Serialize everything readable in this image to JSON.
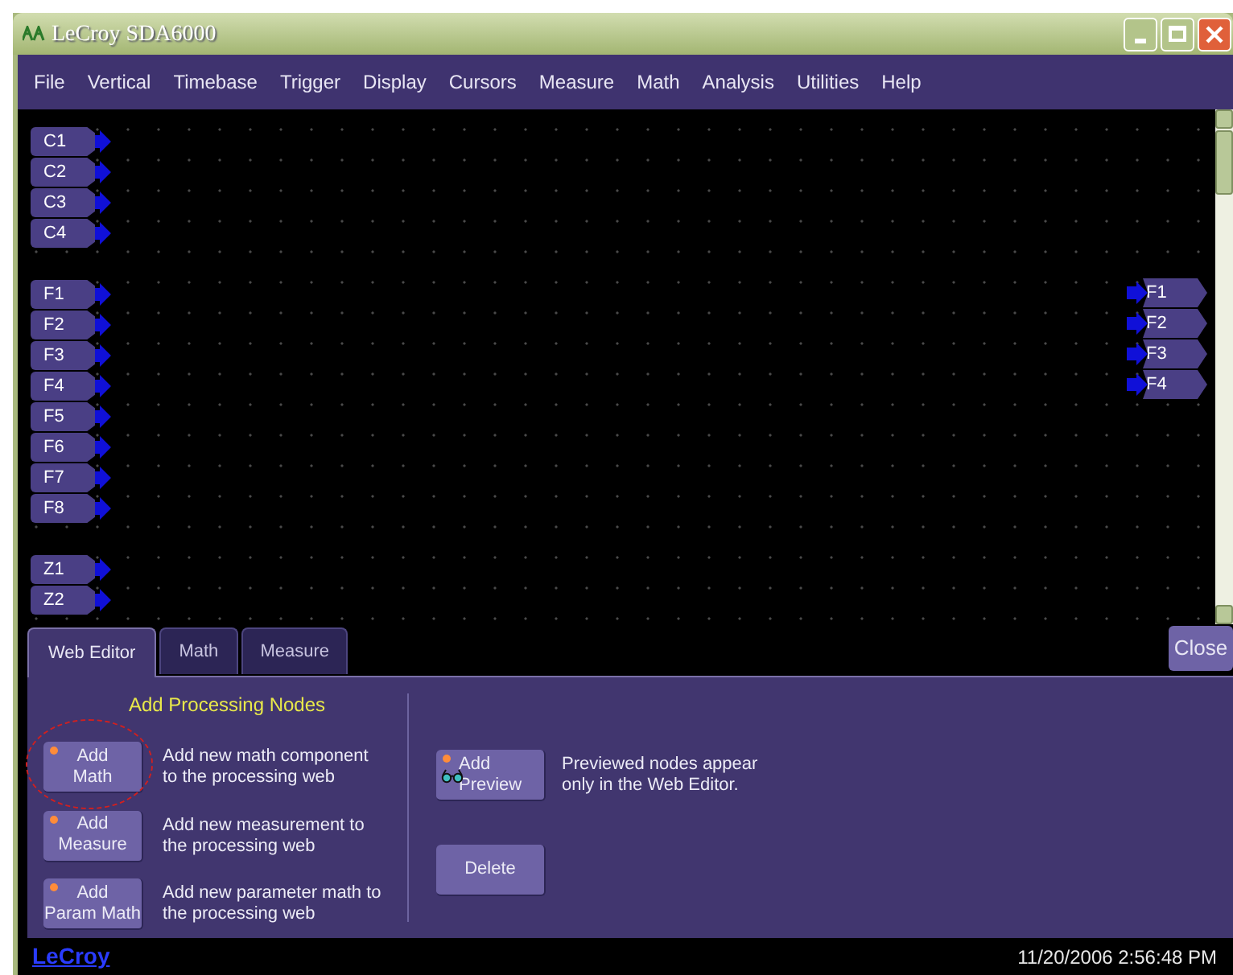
{
  "window": {
    "title": "LeCroy SDA6000"
  },
  "menu": [
    "File",
    "Vertical",
    "Timebase",
    "Trigger",
    "Display",
    "Cursors",
    "Measure",
    "Math",
    "Analysis",
    "Utilities",
    "Help"
  ],
  "web_editor": {
    "input_groups": [
      {
        "nodes": [
          "C1",
          "C2",
          "C3",
          "C4"
        ]
      },
      {
        "nodes": [
          "F1",
          "F2",
          "F3",
          "F4",
          "F5",
          "F6",
          "F7",
          "F8"
        ]
      },
      {
        "nodes": [
          "Z1",
          "Z2"
        ]
      }
    ],
    "output_nodes": [
      "F1",
      "F2",
      "F3",
      "F4"
    ]
  },
  "close_button": "Close",
  "tabs": [
    {
      "label": "Web Editor",
      "selected": true
    },
    {
      "label": "Math",
      "selected": false
    },
    {
      "label": "Measure",
      "selected": false
    }
  ],
  "panel": {
    "heading": "Add Processing Nodes",
    "actions": [
      {
        "label": "Add\nMath",
        "description": "Add new math component\nto the processing web",
        "led": true,
        "highlighted": true
      },
      {
        "label": "Add\nMeasure",
        "description": "Add new measurement to\nthe processing web",
        "led": true,
        "highlighted": false
      },
      {
        "label": "Add\nParam Math",
        "description": "Add new parameter math to\nthe processing web",
        "led": true,
        "highlighted": false
      }
    ],
    "preview": {
      "label": "Add\nPreview",
      "description": "Previewed nodes appear\nonly in the Web Editor.",
      "led": true
    },
    "delete_button": {
      "label": "Delete",
      "led": false
    }
  },
  "status_bar": {
    "brand": "LeCroy",
    "datetime": "11/20/2006 2:56:48 PM"
  }
}
